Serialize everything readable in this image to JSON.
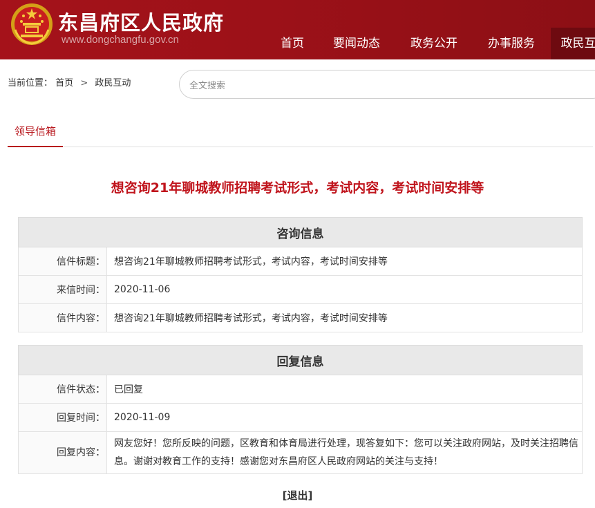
{
  "header": {
    "site_title": "东昌府区人民政府",
    "site_url": "www.dongchangfu.gov.cn",
    "nav": [
      "首页",
      "要闻动态",
      "政务公开",
      "办事服务",
      "政民互"
    ]
  },
  "breadcrumb": {
    "prefix": "当前位置：",
    "items": [
      "首页",
      "政民互动"
    ],
    "separator": ">"
  },
  "search": {
    "placeholder": "全文搜索"
  },
  "tab": {
    "label": "领导信箱"
  },
  "letter_title": "想咨询21年聊城教师招聘考试形式，考试内容，考试时间安排等",
  "inquiry": {
    "heading": "咨询信息",
    "rows": [
      {
        "label": "信件标题：",
        "value": "想咨询21年聊城教师招聘考试形式，考试内容，考试时间安排等"
      },
      {
        "label": "来信时间：",
        "value": "2020-11-06"
      },
      {
        "label": "信件内容：",
        "value": "想咨询21年聊城教师招聘考试形式，考试内容，考试时间安排等"
      }
    ]
  },
  "reply": {
    "heading": "回复信息",
    "rows": [
      {
        "label": "信件状态：",
        "value": "已回复"
      },
      {
        "label": "回复时间：",
        "value": "2020-11-09"
      },
      {
        "label": "回复内容：",
        "value": "网友您好！您所反映的问题，区教育和体育局进行处理，现答复如下：您可以关注政府网站，及时关注招聘信息。谢谢对教育工作的支持！感谢您对东昌府区人民政府网站的关注与支持！"
      }
    ]
  },
  "exit_label": "[退出]",
  "colors": {
    "header_red": "#a5121a",
    "accent_red": "#c0141c",
    "nav_active": "#6e0a10"
  }
}
